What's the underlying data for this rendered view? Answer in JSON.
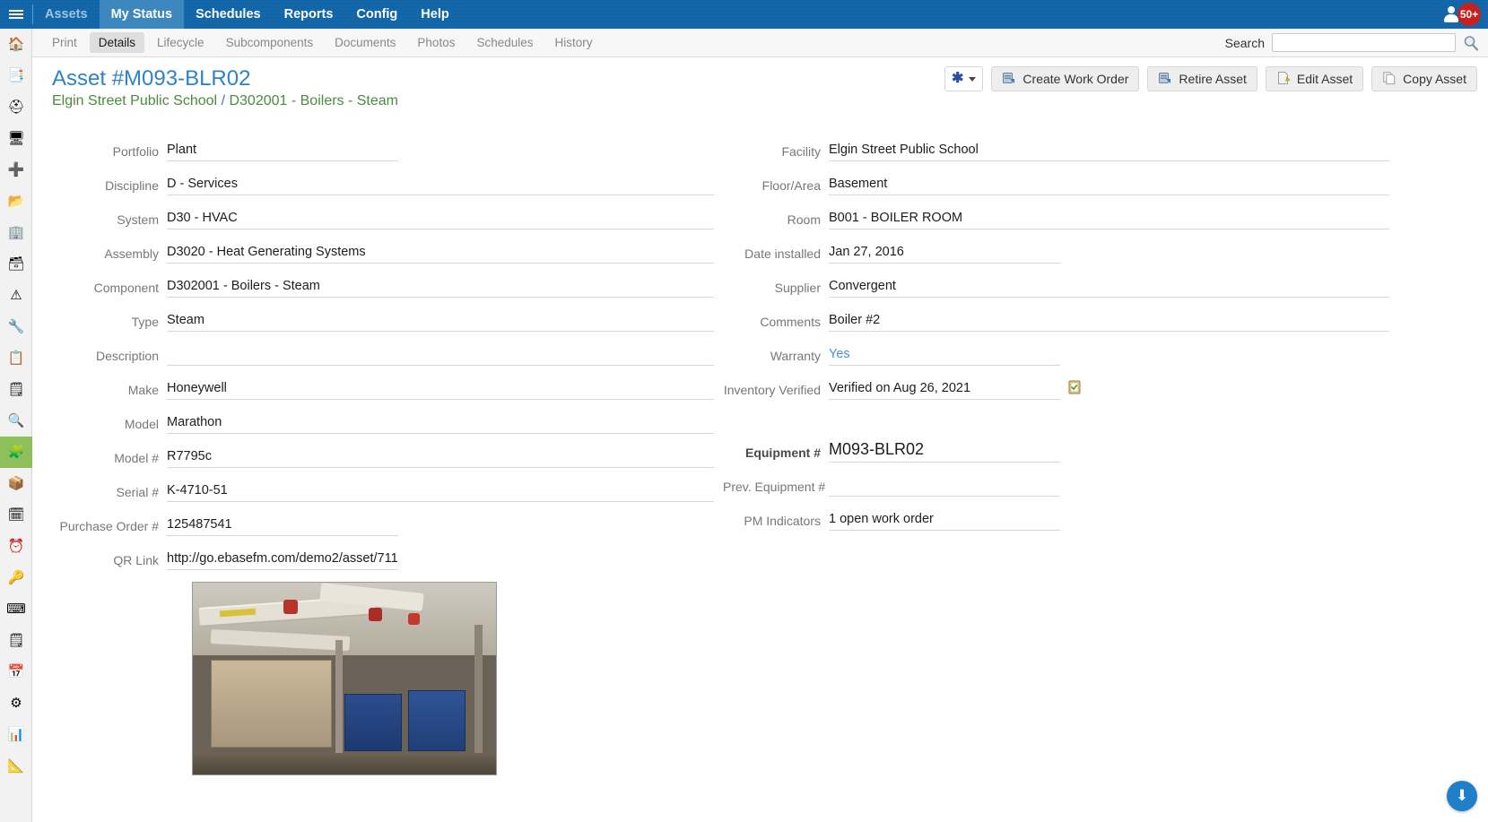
{
  "topnav": {
    "menu_icon": "hamburger-icon",
    "items": [
      {
        "label": "Assets",
        "state": "dim"
      },
      {
        "label": "My Status",
        "state": "active"
      },
      {
        "label": "Schedules",
        "state": "normal"
      },
      {
        "label": "Reports",
        "state": "normal"
      },
      {
        "label": "Config",
        "state": "normal"
      },
      {
        "label": "Help",
        "state": "normal"
      }
    ],
    "user_badge": "50+",
    "accent_color": "#1266a8",
    "badge_color": "#c8201d"
  },
  "sidebar": {
    "items": [
      {
        "name": "home-icon",
        "glyph": "🏠"
      },
      {
        "name": "documents-icon",
        "glyph": "📑"
      },
      {
        "name": "hardhat-icon",
        "glyph": "⛑"
      },
      {
        "name": "workstation-icon",
        "glyph": "🖥"
      },
      {
        "name": "first-aid-icon",
        "glyph": "➕"
      },
      {
        "name": "open-folder-icon",
        "glyph": "📂"
      },
      {
        "name": "building-icon",
        "glyph": "🏢"
      },
      {
        "name": "archive-icon",
        "glyph": "🗃"
      },
      {
        "name": "hazard-icon",
        "glyph": "⚠"
      },
      {
        "name": "wrench-icon",
        "glyph": "🔧"
      },
      {
        "name": "clipboard-check-icon",
        "glyph": "📋"
      },
      {
        "name": "clipboard-icon",
        "glyph": "🗒"
      },
      {
        "name": "inspection-icon",
        "glyph": "🔍"
      },
      {
        "name": "puzzle-icon",
        "glyph": "🧩",
        "selected": true
      },
      {
        "name": "package-icon",
        "glyph": "📦"
      },
      {
        "name": "calendar-task-icon",
        "glyph": "🗓"
      },
      {
        "name": "clock-icon",
        "glyph": "⏰"
      },
      {
        "name": "key-icon",
        "glyph": "🔑"
      },
      {
        "name": "keyboard-icon",
        "glyph": "⌨"
      },
      {
        "name": "note-icon",
        "glyph": "🗒"
      },
      {
        "name": "calendar-icon",
        "glyph": "📅"
      },
      {
        "name": "settings-icon",
        "glyph": "⚙"
      },
      {
        "name": "chart-icon",
        "glyph": "📊"
      },
      {
        "name": "grid-icon",
        "glyph": "📐"
      }
    ]
  },
  "subbar": {
    "tabs": [
      {
        "label": "Print",
        "active": false
      },
      {
        "label": "Details",
        "active": true
      },
      {
        "label": "Lifecycle",
        "active": false
      },
      {
        "label": "Subcomponents",
        "active": false
      },
      {
        "label": "Documents",
        "active": false
      },
      {
        "label": "Photos",
        "active": false
      },
      {
        "label": "Schedules",
        "active": false
      },
      {
        "label": "History",
        "active": false
      }
    ],
    "search_label": "Search",
    "search_value": "",
    "search_placeholder": "",
    "search_icon": "magnifier-icon"
  },
  "page": {
    "title": "Asset #M093-BLR02",
    "breadcrumb_facility": "Elgin Street Public School",
    "breadcrumb_sep": "/",
    "breadcrumb_component": "D302001 - Boilers - Steam"
  },
  "actions": {
    "star_glyph": "✱",
    "create_work_order": "Create Work Order",
    "retire_asset": "Retire Asset",
    "edit_asset": "Edit Asset",
    "copy_asset": "Copy Asset"
  },
  "form": {
    "left": [
      {
        "label": "Portfolio",
        "value": "Plant",
        "width": "short"
      },
      {
        "label": "Discipline",
        "value": "D - Services",
        "width": "full"
      },
      {
        "label": "System",
        "value": "D30 - HVAC",
        "width": "full"
      },
      {
        "label": "Assembly",
        "value": "D3020 - Heat Generating Systems",
        "width": "full"
      },
      {
        "label": "Component",
        "value": "D302001 - Boilers - Steam",
        "width": "full"
      },
      {
        "label": "Type",
        "value": "Steam",
        "width": "full"
      },
      {
        "label": "Description",
        "value": "",
        "width": "full"
      },
      {
        "label": "Make",
        "value": "Honeywell",
        "width": "full"
      },
      {
        "label": "Model",
        "value": "Marathon",
        "width": "full"
      },
      {
        "label": "Model #",
        "value": "R7795c",
        "width": "full"
      },
      {
        "label": "Serial #",
        "value": "K-4710-51",
        "width": "full"
      },
      {
        "label": "Purchase Order #",
        "value": "125487541",
        "width": "short"
      },
      {
        "label": "QR Link",
        "value": "http://go.ebasefm.com/demo2/asset/711",
        "width": "short"
      }
    ],
    "right": [
      {
        "label": "Facility",
        "value": "Elgin Street Public School",
        "width": "wide"
      },
      {
        "label": "Floor/Area",
        "value": "Basement",
        "width": "wide"
      },
      {
        "label": "Room",
        "value": "B001 - BOILER ROOM",
        "width": "wide"
      },
      {
        "label": "Date installed",
        "value": "Jan 27, 2016",
        "width": "med"
      },
      {
        "label": "Supplier",
        "value": "Convergent",
        "width": "wide"
      },
      {
        "label": "Comments",
        "value": "Boiler #2",
        "width": "wide"
      },
      {
        "label": "Warranty",
        "value": "Yes",
        "width": "mid",
        "link": true
      },
      {
        "label": "Inventory Verified",
        "value": "Verified on Aug 26, 2021",
        "width": "short",
        "icon": "verify-clipboard-icon"
      }
    ],
    "equipment": [
      {
        "label": "Equipment #",
        "value": "M093-BLR02"
      },
      {
        "label": "Prev. Equipment #",
        "value": ""
      },
      {
        "label": "PM Indicators",
        "value": "1 open work order"
      }
    ]
  },
  "photo": {
    "name": "asset-photo",
    "alt": "Boiler room photograph"
  },
  "fab": {
    "name": "scroll-down-button",
    "glyph": "⬇"
  }
}
